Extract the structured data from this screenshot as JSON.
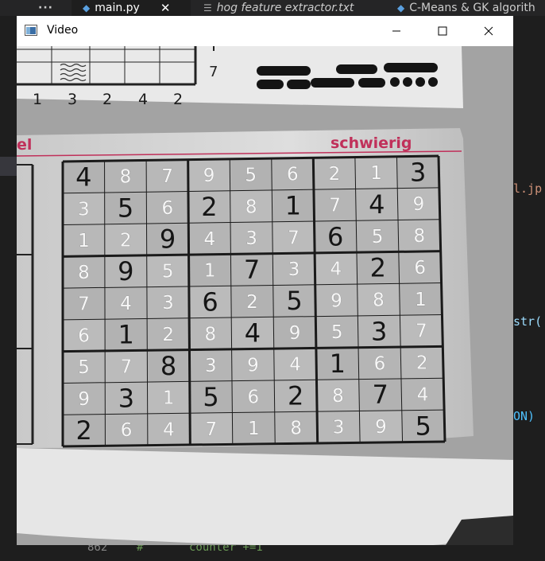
{
  "editor": {
    "tabs": [
      {
        "label": "main.py",
        "icon": "python-icon"
      },
      {
        "label": "hog feature extractor.txt",
        "icon": "text-file-icon"
      },
      {
        "label": "C-Means & GK algorith",
        "icon": "python-icon"
      }
    ],
    "more_label": "···",
    "close_glyph": "✕",
    "code_fragments": {
      "frag1": "l.jp",
      "frag2": "str(",
      "frag3": "ON)"
    },
    "bottom_line": {
      "number": "862",
      "hash": "#",
      "text": "counter +=1"
    }
  },
  "window": {
    "title": "Video",
    "controls": {
      "minimize": "minimize-icon",
      "maximize": "maximize-icon",
      "close": "close-icon"
    }
  },
  "newspaper": {
    "top_number": "7",
    "digit_row": [
      "1",
      "3",
      "2",
      "4",
      "2"
    ],
    "label_left": "el",
    "label_right": "schwierig",
    "accent_color": "#c0305a"
  },
  "sudoku": {
    "grid": [
      [
        "4",
        "8",
        "7",
        "9",
        "5",
        "6",
        "2",
        "1",
        "3"
      ],
      [
        "3",
        "5",
        "6",
        "2",
        "8",
        "1",
        "7",
        "4",
        "9"
      ],
      [
        "1",
        "2",
        "9",
        "4",
        "3",
        "7",
        "6",
        "5",
        "8"
      ],
      [
        "8",
        "9",
        "5",
        "1",
        "7",
        "3",
        "4",
        "2",
        "6"
      ],
      [
        "7",
        "4",
        "3",
        "6",
        "2",
        "5",
        "9",
        "8",
        "1"
      ],
      [
        "6",
        "1",
        "2",
        "8",
        "4",
        "9",
        "5",
        "3",
        "7"
      ],
      [
        "5",
        "7",
        "8",
        "3",
        "9",
        "4",
        "1",
        "6",
        "2"
      ],
      [
        "9",
        "3",
        "1",
        "5",
        "6",
        "2",
        "8",
        "7",
        "4"
      ],
      [
        "2",
        "6",
        "4",
        "7",
        "1",
        "8",
        "3",
        "9",
        "5"
      ]
    ],
    "dark_cells": [
      [
        0,
        0
      ],
      [
        0,
        8
      ],
      [
        1,
        1
      ],
      [
        1,
        3
      ],
      [
        1,
        5
      ],
      [
        1,
        7
      ],
      [
        2,
        2
      ],
      [
        2,
        6
      ],
      [
        3,
        1
      ],
      [
        3,
        4
      ],
      [
        3,
        7
      ],
      [
        4,
        3
      ],
      [
        4,
        5
      ],
      [
        5,
        1
      ],
      [
        5,
        4
      ],
      [
        5,
        7
      ],
      [
        6,
        2
      ],
      [
        6,
        6
      ],
      [
        7,
        1
      ],
      [
        7,
        3
      ],
      [
        7,
        5
      ],
      [
        7,
        7
      ],
      [
        8,
        0
      ],
      [
        8,
        8
      ]
    ]
  }
}
